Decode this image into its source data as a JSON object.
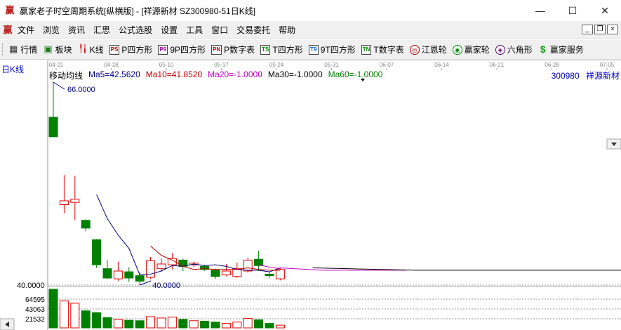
{
  "window": {
    "title": "赢家老子时空周期系统[纵横版] - [祥源新材  SZ300980-51日K线]",
    "app_icon": "赢",
    "buttons": {
      "minimize": "—",
      "maximize": "☐",
      "close": "✕"
    }
  },
  "menu": {
    "icon": "赢",
    "items": [
      "文件",
      "浏览",
      "资讯",
      "汇思",
      "公式选股",
      "设置",
      "工具",
      "窗口",
      "交易委托",
      "帮助"
    ],
    "mdi": {
      "minimize": "_",
      "restore": "❐",
      "close": "×"
    }
  },
  "toolbar": {
    "items": [
      {
        "label": "行情",
        "icon": "▦",
        "icon_name": "grid-icon"
      },
      {
        "label": "板块",
        "icon": "▣",
        "icon_name": "sector-icon"
      },
      {
        "label": "K线",
        "icon": "╿╽",
        "icon_name": "kline-icon"
      },
      {
        "label": "P四方形",
        "icon": "PS",
        "icon_name": "ps-icon"
      },
      {
        "label": "9P四方形",
        "icon": "P9",
        "icon_name": "p9-icon"
      },
      {
        "label": "P数字表",
        "icon": "PN",
        "icon_name": "pn-icon"
      },
      {
        "label": "T四方形",
        "icon": "TS",
        "icon_name": "ts-icon"
      },
      {
        "label": "9T四方形",
        "icon": "T9",
        "icon_name": "t9-icon"
      },
      {
        "label": "T数字表",
        "icon": "TN",
        "icon_name": "tn-icon"
      },
      {
        "label": "江恩轮",
        "icon": "◎",
        "icon_name": "gann-wheel-icon"
      },
      {
        "label": "赢家轮",
        "icon": "◉",
        "icon_name": "winner-wheel-icon"
      },
      {
        "label": "六角形",
        "icon": "◈",
        "icon_name": "hexagon-icon"
      },
      {
        "label": "赢家服务",
        "icon": "$",
        "icon_name": "dollar-icon"
      }
    ]
  },
  "chart_header": {
    "period": "日K线",
    "ma_title": "移动均线",
    "ma_values": [
      {
        "text": "Ma5=42.5620",
        "color": "#000080"
      },
      {
        "text": "Ma10=41.8520",
        "color": "#c00000"
      },
      {
        "text": "Ma20=-1.0000",
        "color": "#c000c0"
      },
      {
        "text": "Ma30=-1.0000",
        "color": "#000000"
      },
      {
        "text": "Ma60=-1.0000",
        "color": "#008000"
      }
    ],
    "code": "300980",
    "name": "祥源新材"
  },
  "chart_data": {
    "type": "candlestick",
    "date_ticks": [
      "04-21",
      "04-28",
      "05-10",
      "05-17",
      "05-24",
      "05-31",
      "06-07",
      "06-14",
      "06-21",
      "06-28",
      "07-05"
    ],
    "price_label_low": "40.0000",
    "high_annotation": "66.0000",
    "low_annotation": "40.0000",
    "volume_ticks": [
      "64595",
      "43063",
      "21532"
    ],
    "candles": [
      {
        "o": 61.5,
        "c": 59.0,
        "h": 66.0,
        "l": 59.0,
        "v": 86000
      },
      {
        "o": 50.3,
        "c": 50.8,
        "h": 54.1,
        "l": 49.2,
        "v": 60000
      },
      {
        "o": 50.6,
        "c": 51.0,
        "h": 54.0,
        "l": 48.3,
        "v": 55000
      },
      {
        "o": 48.3,
        "c": 47.3,
        "h": 48.4,
        "l": 46.9,
        "v": 38000
      },
      {
        "o": 45.8,
        "c": 42.6,
        "h": 45.9,
        "l": 42.2,
        "v": 34000
      },
      {
        "o": 42.1,
        "c": 40.9,
        "h": 43.2,
        "l": 40.8,
        "v": 23000
      },
      {
        "o": 40.8,
        "c": 41.8,
        "h": 43.0,
        "l": 40.5,
        "v": 19000
      },
      {
        "o": 41.7,
        "c": 40.9,
        "h": 42.3,
        "l": 40.4,
        "v": 17000
      },
      {
        "o": 41.2,
        "c": 40.5,
        "h": 41.6,
        "l": 40.0,
        "v": 16000
      },
      {
        "o": 41.0,
        "c": 43.1,
        "h": 43.6,
        "l": 40.8,
        "v": 25000
      },
      {
        "o": 42.1,
        "c": 42.7,
        "h": 43.4,
        "l": 41.8,
        "v": 22000
      },
      {
        "o": 42.6,
        "c": 43.4,
        "h": 44.1,
        "l": 42.0,
        "v": 24000
      },
      {
        "o": 43.2,
        "c": 42.4,
        "h": 43.4,
        "l": 41.8,
        "v": 19000
      },
      {
        "o": 42.6,
        "c": 42.8,
        "h": 43.0,
        "l": 42.3,
        "v": 16000
      },
      {
        "o": 42.4,
        "c": 42.0,
        "h": 42.6,
        "l": 41.8,
        "v": 15000
      },
      {
        "o": 41.9,
        "c": 41.1,
        "h": 42.1,
        "l": 40.8,
        "v": 13000
      },
      {
        "o": 41.3,
        "c": 41.8,
        "h": 42.7,
        "l": 41.1,
        "v": 10000
      },
      {
        "o": 41.1,
        "c": 42.1,
        "h": 42.9,
        "l": 40.9,
        "v": 13000
      },
      {
        "o": 41.8,
        "c": 43.2,
        "h": 43.5,
        "l": 41.6,
        "v": 21000
      },
      {
        "o": 43.3,
        "c": 42.5,
        "h": 44.4,
        "l": 41.8,
        "v": 18000
      },
      {
        "o": 41.4,
        "c": 41.2,
        "h": 41.7,
        "l": 40.9,
        "v": 10000
      },
      {
        "o": 40.8,
        "c": 42.0,
        "h": 42.2,
        "l": 40.6,
        "v": 6000
      }
    ],
    "ma5": [
      null,
      null,
      null,
      null,
      51.6,
      48.5,
      46.4,
      44.7,
      41.3,
      41.4,
      41.8,
      42.5,
      42.4,
      42.7,
      42.5,
      42.6,
      42.4,
      42.0,
      41.9,
      41.9,
      41.7,
      42.2
    ],
    "ma10": [
      null,
      null,
      null,
      null,
      null,
      null,
      null,
      null,
      null,
      45.0,
      43.8,
      43.2,
      42.4,
      42.0,
      42.1,
      42.0,
      42.0,
      42.0,
      42.2,
      42.0,
      41.9,
      41.9
    ],
    "ma20": [
      null,
      null,
      null,
      null,
      null,
      null,
      null,
      null,
      null,
      null,
      null,
      null,
      null,
      null,
      null,
      null,
      null,
      null,
      null,
      42.6,
      42.3,
      42.1
    ],
    "projection_ma20": [
      42.2,
      42.1,
      42.0,
      41.9,
      41.9,
      41.9,
      41.9,
      41.9,
      41.9,
      41.9
    ],
    "projection_ma30": [
      42.2,
      42.1,
      42.0,
      41.9,
      41.9,
      41.9,
      41.9,
      41.9,
      41.9,
      41.9,
      41.9,
      41.9,
      41.9
    ],
    "colors": {
      "up": "#e00000",
      "down": "#008000",
      "axis": "#000080",
      "grid": "#999999"
    }
  }
}
